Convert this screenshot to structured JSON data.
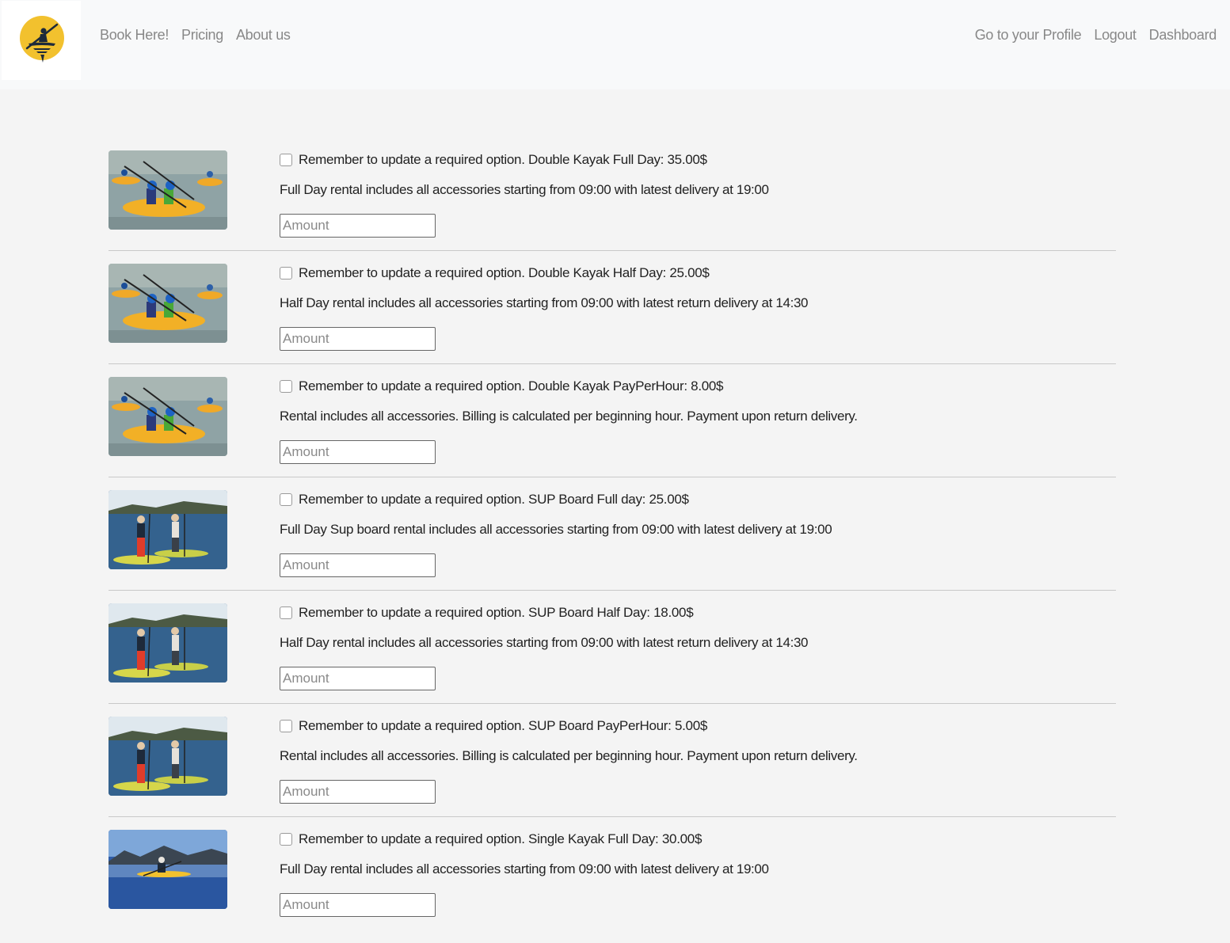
{
  "nav": {
    "left_links": [
      "Book Here!",
      "Pricing",
      "About us"
    ],
    "right_links": [
      "Go to your Profile",
      "Logout",
      "Dashboard"
    ]
  },
  "colors": {
    "logo_sun": "#f2c12e",
    "logo_silhouette": "#1e2a3a",
    "link": "#888888"
  },
  "items": [
    {
      "image": "double-kayak-photo",
      "title": "Remember to update a required option. Double Kayak Full Day: 35.00$",
      "description": "Full Day rental includes all accessories starting from 09:00 with latest delivery at 19:00",
      "amount_placeholder": "Amount",
      "checked": false
    },
    {
      "image": "double-kayak-photo",
      "title": "Remember to update a required option. Double Kayak Half Day: 25.00$",
      "description": "Half Day rental includes all accessories starting from 09:00 with latest return delivery at 14:30",
      "amount_placeholder": "Amount",
      "checked": false
    },
    {
      "image": "double-kayak-photo",
      "title": "Remember to update a required option. Double Kayak PayPerHour: 8.00$",
      "description": "Rental includes all accessories. Billing is calculated per beginning hour. Payment upon return delivery.",
      "amount_placeholder": "Amount",
      "checked": false
    },
    {
      "image": "sup-board-photo",
      "title": "Remember to update a required option. SUP Board Full day: 25.00$",
      "description": "Full Day Sup board rental includes all accessories starting from 09:00 with latest delivery at 19:00",
      "amount_placeholder": "Amount",
      "checked": false
    },
    {
      "image": "sup-board-photo",
      "title": "Remember to update a required option. SUP Board Half Day: 18.00$",
      "description": "Half Day rental includes all accessories starting from 09:00 with latest return delivery at 14:30",
      "amount_placeholder": "Amount",
      "checked": false
    },
    {
      "image": "sup-board-photo",
      "title": "Remember to update a required option. SUP Board PayPerHour: 5.00$",
      "description": "Rental includes all accessories. Billing is calculated per beginning hour. Payment upon return delivery.",
      "amount_placeholder": "Amount",
      "checked": false
    },
    {
      "image": "single-kayak-photo",
      "title": "Remember to update a required option. Single Kayak Full Day: 30.00$",
      "description": "Full Day rental includes all accessories starting from 09:00 with latest delivery at 19:00",
      "amount_placeholder": "Amount",
      "checked": false
    }
  ]
}
